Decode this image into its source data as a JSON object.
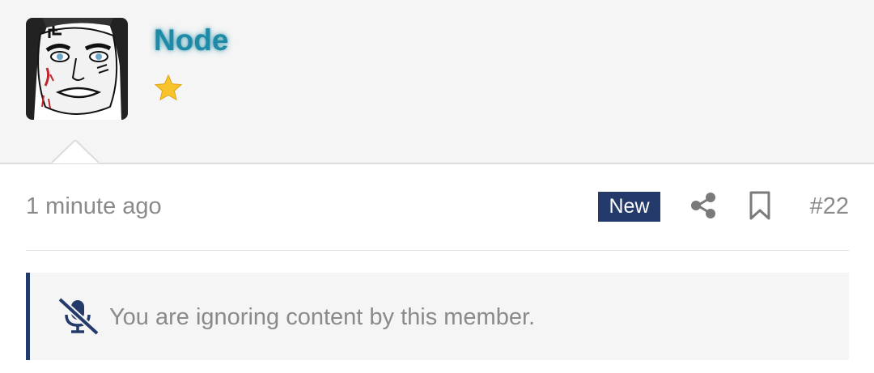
{
  "user": {
    "name": "Node",
    "avatar_icon": "cartoon-face-avatar",
    "badge_icon": "star-icon",
    "name_color": "#1f8aa6"
  },
  "post": {
    "time": "1 minute ago",
    "new_label": "New",
    "share_icon": "share-icon",
    "bookmark_icon": "bookmark-icon",
    "number": "#22"
  },
  "notice": {
    "icon": "microphone-slash-icon",
    "text": "You are ignoring content by this member."
  },
  "colors": {
    "accent": "#233a6b",
    "muted_text": "#8a8a8a",
    "header_bg": "#f5f5f5"
  }
}
